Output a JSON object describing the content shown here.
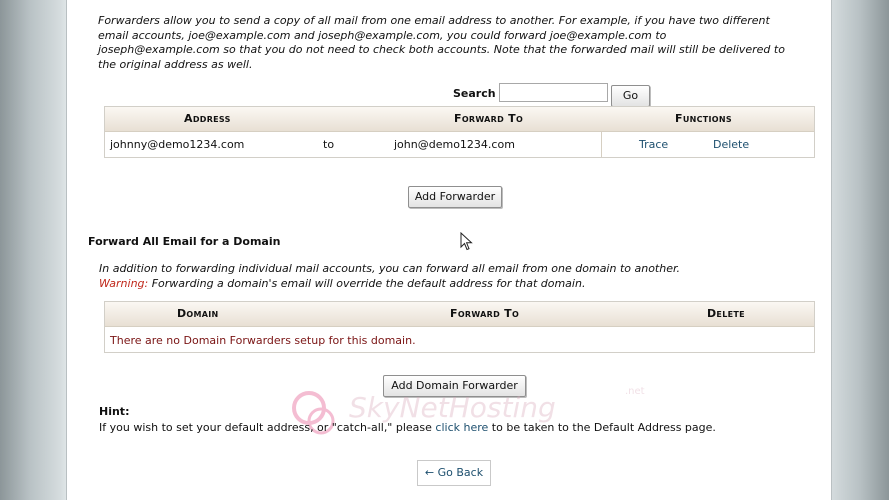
{
  "intro": {
    "line1": "Forwarders allow you to send a copy of all mail from one email address to another. For example, if you have two different",
    "line2": "email accounts, joe@example.com and joseph@example.com, you could forward joe@example.com to",
    "line3": "joseph@example.com so that you do not need to check both accounts. Note that the forwarded mail will still be delivered to",
    "line4": "the original address as well."
  },
  "search": {
    "label": "Search",
    "value": "",
    "go_label": "Go"
  },
  "forwarders_table": {
    "headers": {
      "address": "Address",
      "forward_to": "Forward To",
      "functions": "Functions"
    },
    "rows": [
      {
        "address": "johnny@demo1234.com",
        "to": "to",
        "forward_to": "john@demo1234.com",
        "trace": "Trace",
        "delete": "Delete"
      }
    ]
  },
  "add_forwarder_label": "Add Forwarder",
  "domain_section": {
    "heading": "Forward All Email for a Domain",
    "desc": "In addition to forwarding individual mail accounts, you can forward all email from one domain to another.",
    "warning_label": "Warning:",
    "warning_text": " Forwarding a domain's email will override the default address for that domain."
  },
  "domain_table": {
    "headers": {
      "domain": "Domain",
      "forward_to": "Forward To",
      "delete": "Delete"
    },
    "empty_message": "There are no Domain Forwarders setup for this domain."
  },
  "add_domain_forwarder_label": "Add Domain Forwarder",
  "hint": {
    "title": "Hint:",
    "text_before": "If you wish to set your default address, or \"catch-all,\" please ",
    "link": "click here",
    "text_after": " to be taken to the Default Address page."
  },
  "go_back_label": "← Go Back",
  "watermark": {
    "brand": "SkyNetHosting",
    "tld": ".net"
  }
}
